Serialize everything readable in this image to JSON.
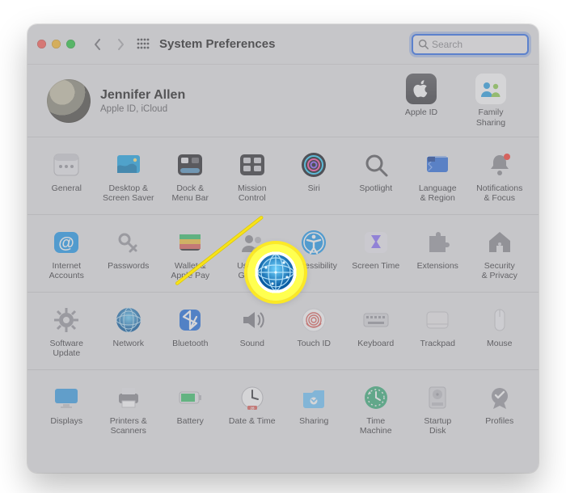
{
  "titlebar": {
    "title": "System Preferences",
    "search_placeholder": "Search"
  },
  "profile": {
    "name": "Jennifer Allen",
    "subtitle": "Apple ID, iCloud",
    "account_items": [
      {
        "id": "apple-id",
        "label": "Apple ID"
      },
      {
        "id": "family-sharing",
        "label": "Family\nSharing"
      }
    ]
  },
  "highlighted_pref": "network",
  "sections": [
    {
      "id": "row1",
      "items": [
        {
          "id": "general",
          "label": "General",
          "icon": "general"
        },
        {
          "id": "desktop",
          "label": "Desktop &\nScreen Saver",
          "icon": "desktop"
        },
        {
          "id": "dock",
          "label": "Dock &\nMenu Bar",
          "icon": "dock"
        },
        {
          "id": "mission-control",
          "label": "Mission\nControl",
          "icon": "mission"
        },
        {
          "id": "siri",
          "label": "Siri",
          "icon": "siri"
        },
        {
          "id": "spotlight",
          "label": "Spotlight",
          "icon": "spotlight"
        },
        {
          "id": "language-region",
          "label": "Language\n& Region",
          "icon": "flag"
        },
        {
          "id": "notifications",
          "label": "Notifications\n& Focus",
          "icon": "bell"
        }
      ]
    },
    {
      "id": "row2",
      "items": [
        {
          "id": "internet-accounts",
          "label": "Internet\nAccounts",
          "icon": "at"
        },
        {
          "id": "passwords",
          "label": "Passwords",
          "icon": "key"
        },
        {
          "id": "wallet",
          "label": "Wallet &\nApple Pay",
          "icon": "wallet"
        },
        {
          "id": "users-groups",
          "label": "Users &\nGroups",
          "icon": "users",
          "obscured": true
        },
        {
          "id": "accessibility",
          "label": "Accessibility",
          "icon": "accessibility"
        },
        {
          "id": "screen-time",
          "label": "Screen Time",
          "icon": "hourglass"
        },
        {
          "id": "extensions",
          "label": "Extensions",
          "icon": "puzzle"
        },
        {
          "id": "security-privacy",
          "label": "Security\n& Privacy",
          "icon": "house"
        }
      ]
    },
    {
      "id": "row3",
      "items": [
        {
          "id": "software-update",
          "label": "Software\nUpdate",
          "icon": "gear"
        },
        {
          "id": "network",
          "label": "Network",
          "icon": "network"
        },
        {
          "id": "bluetooth",
          "label": "Bluetooth",
          "icon": "bluetooth"
        },
        {
          "id": "sound",
          "label": "Sound",
          "icon": "speaker"
        },
        {
          "id": "touch-id",
          "label": "Touch ID",
          "icon": "fingerprint"
        },
        {
          "id": "keyboard",
          "label": "Keyboard",
          "icon": "keyboard"
        },
        {
          "id": "trackpad",
          "label": "Trackpad",
          "icon": "trackpad"
        },
        {
          "id": "mouse",
          "label": "Mouse",
          "icon": "mouse"
        }
      ]
    },
    {
      "id": "row4",
      "items": [
        {
          "id": "displays",
          "label": "Displays",
          "icon": "display"
        },
        {
          "id": "printers-scanners",
          "label": "Printers &\nScanners",
          "icon": "printer"
        },
        {
          "id": "battery",
          "label": "Battery",
          "icon": "battery"
        },
        {
          "id": "date-time",
          "label": "Date & Time",
          "icon": "clock"
        },
        {
          "id": "sharing",
          "label": "Sharing",
          "icon": "folder"
        },
        {
          "id": "time-machine",
          "label": "Time\nMachine",
          "icon": "timemachine"
        },
        {
          "id": "startup-disk",
          "label": "Startup\nDisk",
          "icon": "disk"
        },
        {
          "id": "profiles",
          "label": "Profiles",
          "icon": "badge"
        }
      ]
    }
  ]
}
